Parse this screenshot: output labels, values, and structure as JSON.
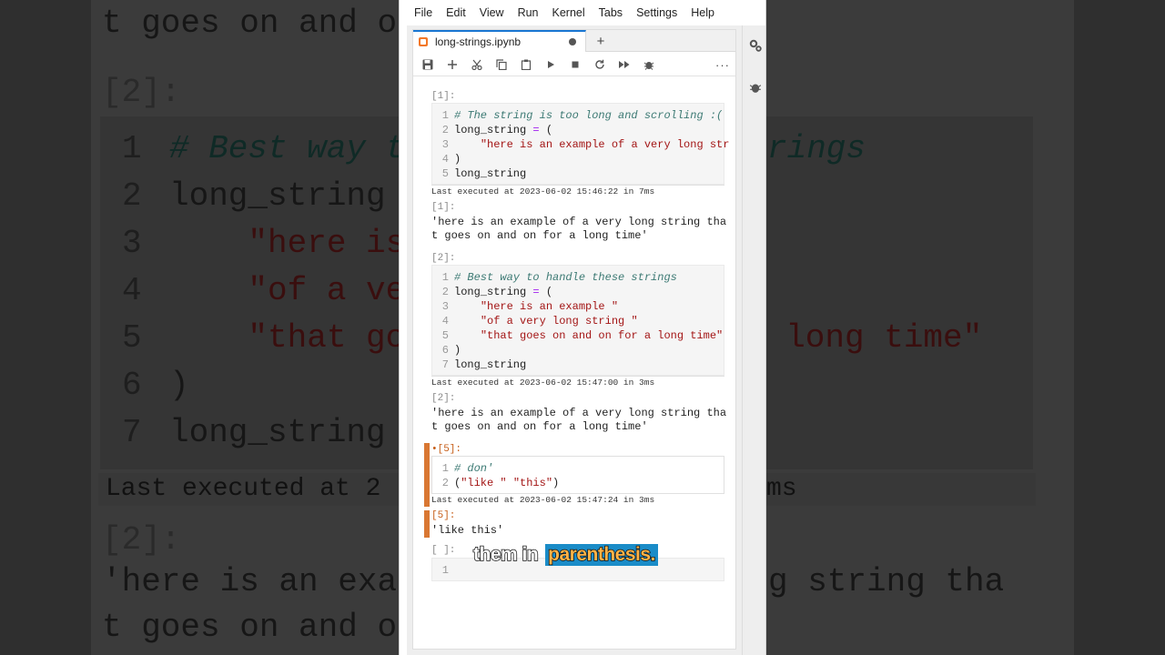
{
  "menu": [
    "File",
    "Edit",
    "View",
    "Run",
    "Kernel",
    "Tabs",
    "Settings",
    "Help"
  ],
  "tab": {
    "title": "long-strings.ipynb",
    "add": "+"
  },
  "toolbar": {
    "icons": [
      "save-icon",
      "add-cell-icon",
      "cut-icon",
      "copy-icon",
      "paste-icon",
      "run-icon",
      "stop-icon",
      "restart-icon",
      "run-all-icon",
      "debug-icon",
      "more-icon"
    ],
    "more": "···"
  },
  "cells": [
    {
      "prompt": "[1]:",
      "lines": [
        [
          {
            "t": "# The string is too long and scrolling :(",
            "c": "comment"
          }
        ],
        [
          {
            "t": "long_string ",
            "c": "name"
          },
          {
            "t": "=",
            "c": "op"
          },
          {
            "t": " (",
            "c": "name"
          }
        ],
        [
          {
            "t": "    ",
            "c": "name"
          },
          {
            "t": "\"here is an example of a very long str",
            "c": "str"
          }
        ],
        [
          {
            "t": ")",
            "c": "name"
          }
        ],
        [
          {
            "t": "long_string",
            "c": "name"
          }
        ]
      ],
      "meta": "Last executed at 2023-06-02 15:46:22 in 7ms",
      "out_prompt": "[1]:",
      "output": "'here is an example of a very long string tha\nt goes on and on for a long time'"
    },
    {
      "prompt": "[2]:",
      "lines": [
        [
          {
            "t": "# Best way to handle these strings",
            "c": "comment"
          }
        ],
        [
          {
            "t": "long_string ",
            "c": "name"
          },
          {
            "t": "=",
            "c": "op"
          },
          {
            "t": " (",
            "c": "name"
          }
        ],
        [
          {
            "t": "    ",
            "c": "name"
          },
          {
            "t": "\"here is an example \"",
            "c": "str"
          }
        ],
        [
          {
            "t": "    ",
            "c": "name"
          },
          {
            "t": "\"of a very long string \"",
            "c": "str"
          }
        ],
        [
          {
            "t": "    ",
            "c": "name"
          },
          {
            "t": "\"that goes on and on for a long time\"",
            "c": "str"
          }
        ],
        [
          {
            "t": ")",
            "c": "name"
          }
        ],
        [
          {
            "t": "long_string",
            "c": "name"
          }
        ]
      ],
      "meta": "Last executed at 2023-06-02 15:47:00 in 3ms",
      "out_prompt": "[2]:",
      "output": "'here is an example of a very long string tha\nt goes on and on for a long time'"
    },
    {
      "prompt": "•[5]:",
      "lines": [
        [
          {
            "t": "# don'",
            "c": "comment"
          }
        ],
        [
          {
            "t": "(",
            "c": "name"
          },
          {
            "t": "\"like \"",
            "c": "str"
          },
          {
            "t": " ",
            "c": "name"
          },
          {
            "t": "\"this\"",
            "c": "str"
          },
          {
            "t": ")",
            "c": "name"
          }
        ]
      ],
      "meta": "Last executed at 2023-06-02 15:47:24 in 3ms",
      "out_prompt": "[5]:",
      "output": "'like this'"
    },
    {
      "prompt": "[ ]:",
      "lines": [
        []
      ]
    }
  ],
  "background": {
    "top_line": "t goes on and o",
    "prompt": "[2]:",
    "lines": [
      {
        "n": "1",
        "t": "# Best way t",
        "tail": "rings",
        "kind": "comment"
      },
      {
        "n": "2",
        "t": "long_string",
        "tail": "",
        "kind": "name"
      },
      {
        "n": "3",
        "t": "    \"here is",
        "tail": "",
        "kind": "str"
      },
      {
        "n": "4",
        "t": "    \"of a ve",
        "tail": "",
        "kind": "str"
      },
      {
        "n": "5",
        "t": "    \"that go",
        "tail": "a long time\"",
        "kind": "str"
      },
      {
        "n": "6",
        "t": ")",
        "tail": "",
        "kind": "name"
      },
      {
        "n": "7",
        "t": "long_string",
        "tail": "",
        "kind": "name"
      }
    ],
    "meta_left": "Last executed at 2",
    "meta_right": "ms",
    "out_prompt": "[2]:",
    "out_line1_left": "'here is an exa",
    "out_line1_right": "g string tha",
    "out_line2_left": "t goes on and o"
  },
  "caption": {
    "part1": "them in",
    "part2": "parenthesis."
  }
}
